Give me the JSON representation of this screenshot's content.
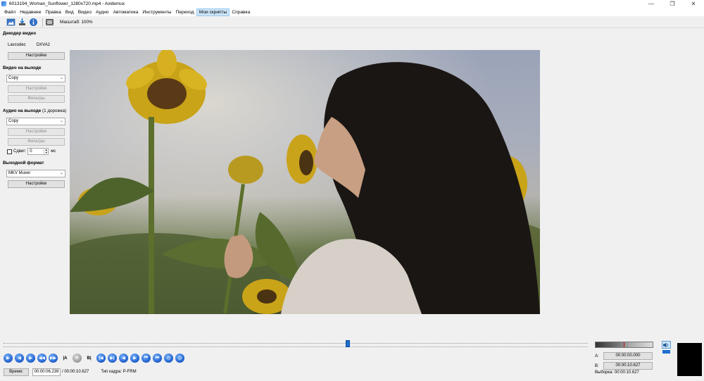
{
  "window": {
    "title": "6013194_Woman_Sunflower_1280x720.mp4 - Avidemux",
    "minimize": "—",
    "restore": "❐",
    "close": "✕"
  },
  "menu": {
    "items": [
      "Файл",
      "Недавнее",
      "Правка",
      "Вид",
      "Видео",
      "Аудио",
      "Автоматика",
      "Инструменты",
      "Переход",
      "Мои скрипты",
      "Справка"
    ],
    "active_index": 9
  },
  "toolbar": {
    "icons": [
      "open-icon",
      "save-icon",
      "info-icon",
      "film-icon"
    ],
    "zoom_label": "Масштаб: 100%"
  },
  "decoder": {
    "title": "Декодер видео",
    "codec": "Lavcodec",
    "hw": "DXVA2",
    "settings": "Настройки"
  },
  "video_out": {
    "title": "Видео на выходе",
    "codec": "Copy",
    "settings": "Настройки",
    "filters": "Фильтры"
  },
  "audio_out": {
    "title": "Аудио на выходе",
    "tracks": "(1 дорожка)",
    "codec": "Copy",
    "settings": "Настройки",
    "filters": "Фильтры",
    "shift_label": "Сдвиг:",
    "shift_value": "0",
    "shift_unit": "мс"
  },
  "output_format": {
    "title": "Выходной формат",
    "muxer": "MKV Muxer",
    "settings": "Настройки"
  },
  "playback": {
    "position_fraction": 0.589,
    "time_button": "Время:",
    "current_time": "00:00:06.239",
    "duration": "/ 00:00:10.627",
    "frame_type": "Тип кадра:  P-FRM",
    "controls": [
      "play",
      "rewind",
      "forward",
      "prev-keyframe",
      "next-keyframe",
      "set-a",
      "reset",
      "set-b",
      "goto-a",
      "goto-b",
      "prev-black",
      "next-black",
      "first-frame",
      "last-frame",
      "back-1min",
      "fwd-1min"
    ]
  },
  "selection": {
    "a_label": "A:",
    "a_value": "00:00:00.000",
    "b_label": "B:",
    "b_value": "00:00:10.627",
    "sel_label": "Выборка: 00:00:10.627"
  }
}
